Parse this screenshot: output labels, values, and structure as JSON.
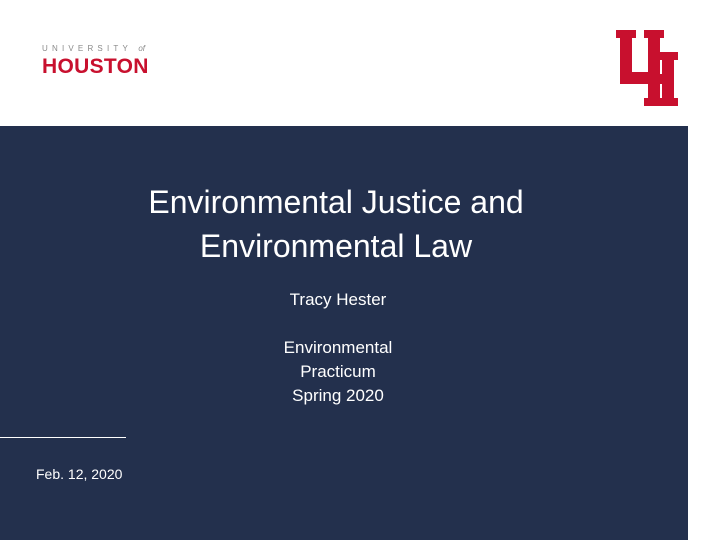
{
  "header": {
    "logo": {
      "line1": "UNIVERSITY",
      "line1_of": "of",
      "line2": "HOUSTON",
      "mark_icon": "uh-interlocking-logo"
    }
  },
  "slide": {
    "title_lines": [
      "Environmental Justice and",
      "Environmental Law"
    ],
    "author": "Tracy Hester",
    "course_lines": [
      "Environmental",
      "Practicum",
      "Spring 2020"
    ],
    "date": "Feb. 12, 2020"
  },
  "colors": {
    "brand_red": "#c8102e",
    "panel_navy": "#23304d",
    "text_white": "#ffffff"
  }
}
